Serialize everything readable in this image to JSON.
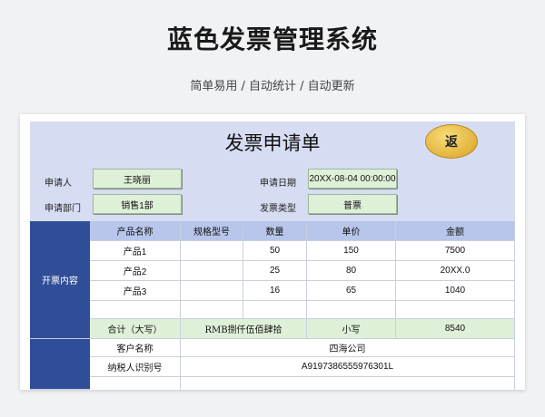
{
  "page": {
    "title": "蓝色发票管理系统",
    "subtitle": "简单易用  /  自动统计  /  自动更新"
  },
  "form": {
    "title": "发票申请单",
    "return_label": "返",
    "applicant_label": "申请人",
    "applicant_value": "王晓丽",
    "date_label": "申请日期",
    "date_value": "20XX-08-04 00:00:00",
    "dept_label": "申请部门",
    "dept_value": "销售1部",
    "type_label": "发票类型",
    "type_value": "普票"
  },
  "table": {
    "section_label": "开票内容",
    "headers": [
      "产品名称",
      "规格型号",
      "数量",
      "单价",
      "金额"
    ],
    "rows": [
      [
        "产品1",
        "",
        "50",
        "150",
        "7500"
      ],
      [
        "产品2",
        "",
        "25",
        "80",
        "20XX.0"
      ],
      [
        "产品3",
        "",
        "16",
        "65",
        "1040"
      ],
      [
        "",
        "",
        "",
        "",
        ""
      ]
    ],
    "total_label": "合计（大写）",
    "total_upper": "RMB捌仟伍佰肆拾",
    "total_small_label": "小写",
    "total_small_value": "8540"
  },
  "client": {
    "name_label": "客户名称",
    "name_value": "四海公司",
    "tax_label": "纳税人识别号",
    "tax_value": "A9197386555976301L"
  },
  "colors": {
    "header_panel": "#d6dcf1",
    "side_blue": "#2f4e97",
    "table_header": "#b7c6ea",
    "field_green": "#dff0d8",
    "badge_gold": "#e3b23c"
  }
}
